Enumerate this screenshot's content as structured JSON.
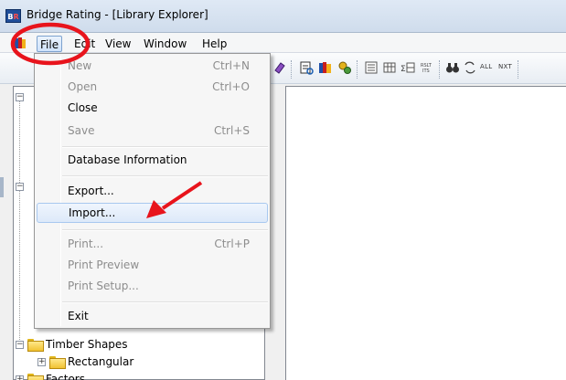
{
  "window": {
    "title": "Bridge Rating - [Library Explorer]",
    "logo_left": "B",
    "logo_right": "R"
  },
  "menubar": {
    "items": [
      "File",
      "Edit",
      "View",
      "Window",
      "Help"
    ]
  },
  "toolbar": {
    "text_buttons": [
      "ALL",
      "NXT"
    ]
  },
  "file_menu": {
    "items": [
      {
        "label": "New",
        "shortcut": "Ctrl+N",
        "enabled": false
      },
      {
        "label": "Open",
        "shortcut": "Ctrl+O",
        "enabled": false
      },
      {
        "label": "Close",
        "shortcut": "",
        "enabled": true
      },
      {
        "label": "Save",
        "shortcut": "Ctrl+S",
        "enabled": false
      },
      {
        "label": "Database Information",
        "shortcut": "",
        "enabled": true
      },
      {
        "label": "Export...",
        "shortcut": "",
        "enabled": true
      },
      {
        "label": "Import...",
        "shortcut": "",
        "enabled": true,
        "highlighted": true
      },
      {
        "label": "Print...",
        "shortcut": "Ctrl+P",
        "enabled": false
      },
      {
        "label": "Print Preview",
        "shortcut": "",
        "enabled": false
      },
      {
        "label": "Print Setup...",
        "shortcut": "",
        "enabled": false
      },
      {
        "label": "Exit",
        "shortcut": "",
        "enabled": true
      }
    ]
  },
  "tree": {
    "visible_items": [
      {
        "label": "Timber Shapes",
        "expanded": true
      },
      {
        "label": "Rectangular",
        "expanded": false
      },
      {
        "label": "Factors",
        "expanded": false
      }
    ]
  },
  "colors": {
    "annotation_red": "#e8141c",
    "menu_highlight": "#dde9f9"
  }
}
